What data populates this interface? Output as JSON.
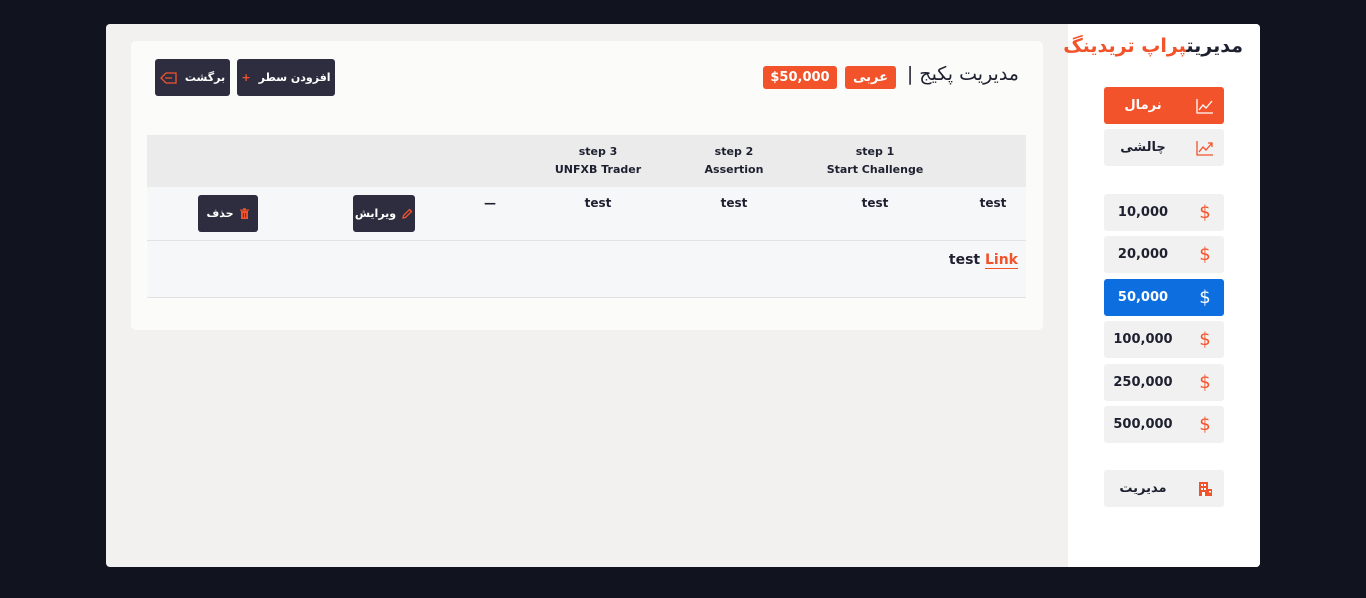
{
  "brand": {
    "part1": "مدیریت",
    "part2": "پراپ تریدینگ"
  },
  "sidebar": {
    "account_types": [
      {
        "label": "نرمال",
        "icon": "chart-line-icon",
        "active": true
      },
      {
        "label": "چالشی",
        "icon": "chart-trend-icon",
        "active": false
      }
    ],
    "balances": [
      {
        "label": "10,000",
        "icon": "dollar-icon",
        "active": false
      },
      {
        "label": "20,000",
        "icon": "dollar-icon",
        "active": false
      },
      {
        "label": "50,000",
        "icon": "dollar-icon",
        "active": true
      },
      {
        "label": "100,000",
        "icon": "dollar-icon",
        "active": false
      },
      {
        "label": "250,000",
        "icon": "dollar-icon",
        "active": false
      },
      {
        "label": "500,000",
        "icon": "dollar-icon",
        "active": false
      }
    ],
    "manage": {
      "label": "مدیریت",
      "icon": "building-icon"
    },
    "dollar_glyph": "$"
  },
  "header": {
    "title": "مدیریت پکیج |",
    "language_badge": "عربی",
    "amount_badge": "$50,000",
    "add_row_label": "افزودن سطر",
    "add_row_glyph": "+",
    "back_label": "برگشت"
  },
  "table": {
    "columns": [
      {
        "line1": "step 1",
        "line2": "Start Challenge"
      },
      {
        "line1": "step 2",
        "line2": "Assertion"
      },
      {
        "line1": "step 3",
        "line2": "UNFXB Trader"
      }
    ],
    "row": {
      "name": "test",
      "cells": [
        "test",
        "test",
        "test"
      ],
      "extra": "—",
      "edit_label": "ویرایش",
      "delete_label": "حذف"
    },
    "link_row": {
      "text": "test",
      "link": "Link"
    }
  },
  "colors": {
    "accent": "#f2532a",
    "active_blue": "#0d6ee0",
    "dark_button": "#2e2d40",
    "page_bg": "#11131f"
  }
}
